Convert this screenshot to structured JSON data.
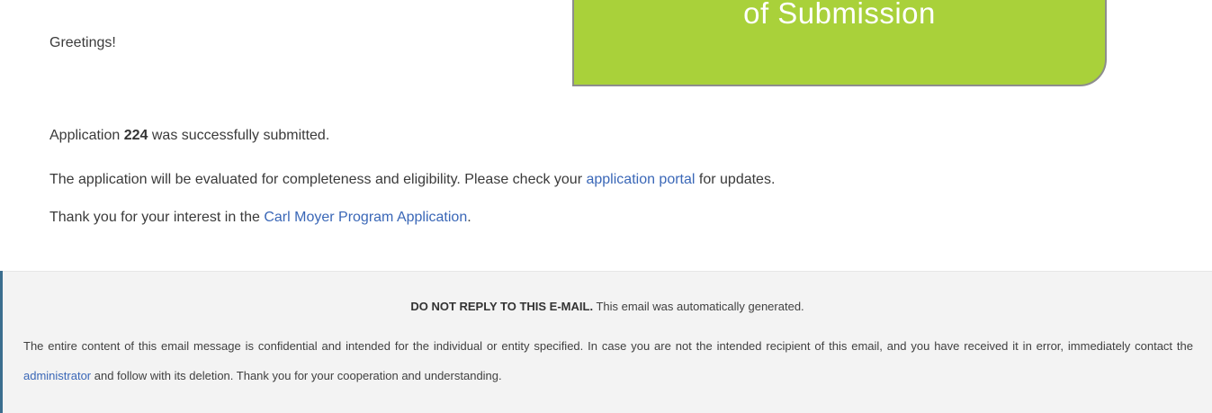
{
  "email": {
    "greeting": "Greetings!",
    "submitted_prefix": "Application ",
    "application_number": "224",
    "submitted_suffix": " was successfully submitted.",
    "evaluated_prefix": "The application will be evaluated for completeness and eligibility. Please check your ",
    "portal_link": "application portal",
    "evaluated_suffix": " for updates.",
    "thanks_prefix": "Thank you for your interest in the ",
    "program_link": "Carl Moyer Program Application",
    "thanks_suffix": "."
  },
  "footer": {
    "notice_bold": "DO NOT REPLY TO THIS E-MAIL.",
    "notice_text": " This email was automatically generated.",
    "legal_prefix": "The entire content of this email message is confidential and intended for the individual or entity specified. In case you are not the intended recipient of this email, and you have received it in error, immediately contact the ",
    "admin_link": "administrator",
    "legal_suffix": " and follow with its deletion. Thank you for your cooperation and understanding."
  },
  "callout": {
    "text": "of Submission"
  },
  "colors": {
    "link": "#3a67b7",
    "callout_fill": "#a9d13a",
    "footer_background": "#f3f3f3",
    "edge_accent": "#3b6e8f"
  }
}
